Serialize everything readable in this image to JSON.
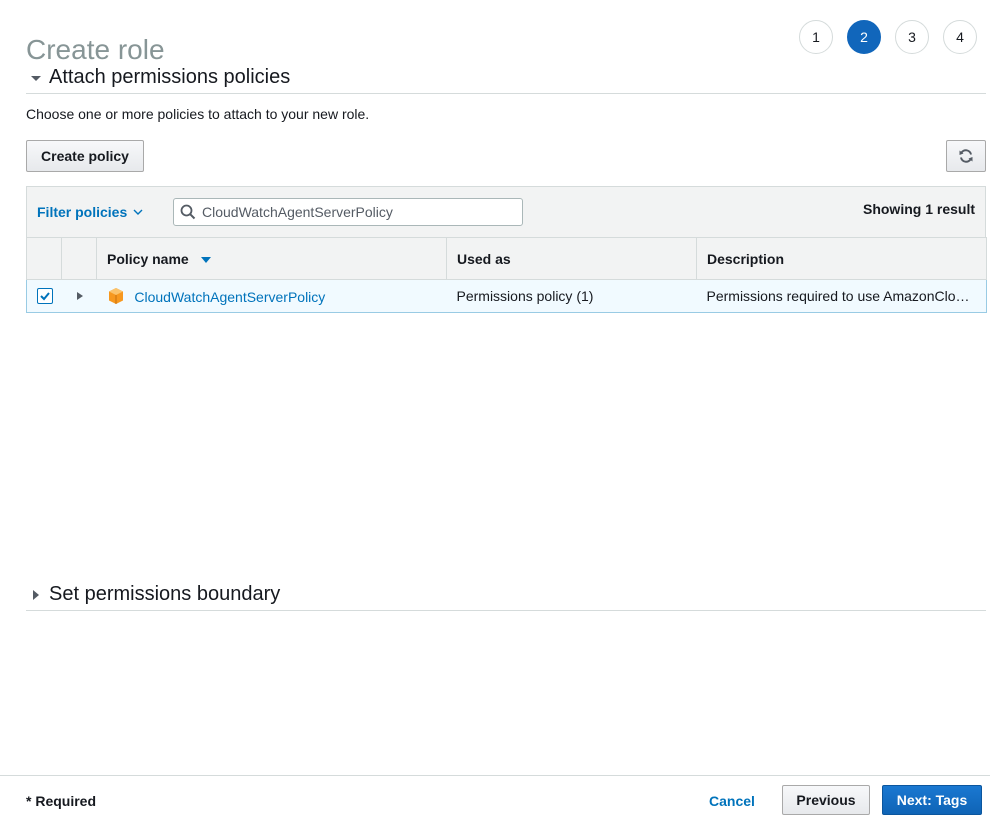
{
  "page": {
    "title": "Create role"
  },
  "steps": [
    "1",
    "2",
    "3",
    "4"
  ],
  "active_step": "2",
  "sections": {
    "attach": {
      "title": "Attach permissions policies",
      "intro": "Choose one or more policies to attach to your new role."
    },
    "boundary": {
      "title": "Set permissions boundary"
    }
  },
  "toolbar": {
    "create_policy_label": "Create policy",
    "refresh_icon": "refresh-icon"
  },
  "filter": {
    "label": "Filter policies",
    "search_value": "CloudWatchAgentServerPolicy",
    "search_placeholder": "Search",
    "result_count": "Showing 1 result"
  },
  "table": {
    "headers": {
      "policy_name": "Policy name",
      "used_as": "Used as",
      "description": "Description"
    },
    "rows": [
      {
        "checked": true,
        "policy_name": "CloudWatchAgentServerPolicy",
        "used_as": "Permissions policy (1)",
        "description": "Permissions required to use AmazonCloudWatchAgent on servers"
      }
    ]
  },
  "footer": {
    "required_label": "* Required",
    "cancel_label": "Cancel",
    "previous_label": "Previous",
    "next_label": "Next: Tags"
  },
  "colors": {
    "accent": "#1166bb",
    "link": "#0073bb",
    "policy_icon": "#f7981f"
  }
}
